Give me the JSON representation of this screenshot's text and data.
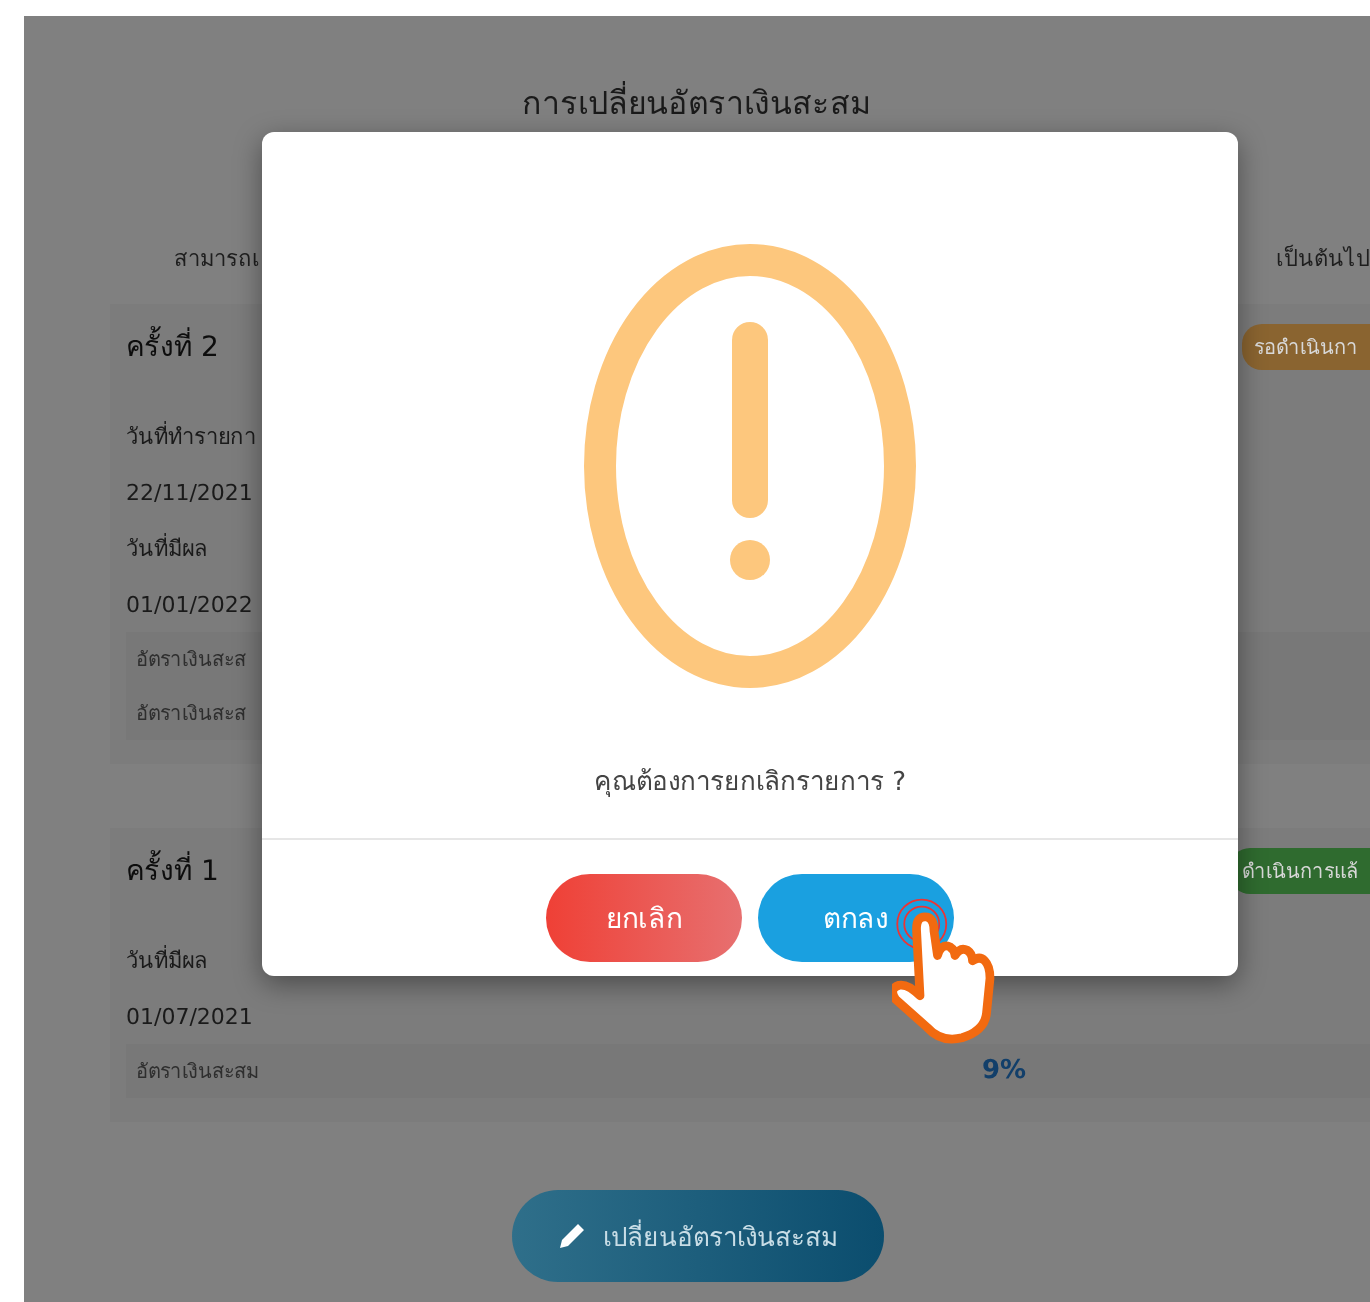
{
  "page": {
    "title": "การเปลี่ยนอัตราเงินสะสม",
    "note_left": "สามารถเ",
    "note_right": "เป็นต้นไป"
  },
  "records": [
    {
      "heading": "ครั้งที่ 2",
      "status": "รอดำเนินกา",
      "color": "#8a6430",
      "fields": [
        {
          "kind": "label",
          "text": "วันที่ทำรายกา"
        },
        {
          "kind": "value",
          "text": "22/11/2021"
        },
        {
          "kind": "label",
          "text": "วันที่มีผล"
        },
        {
          "kind": "value",
          "text": "01/01/2022"
        },
        {
          "kind": "rate",
          "text": "อัตราเงินสะส"
        },
        {
          "kind": "rate",
          "text": "อัตราเงินสะส"
        }
      ]
    },
    {
      "heading": "ครั้งที่ 1",
      "status": "ดำเนินการแล้",
      "color": "#2f6b2f",
      "fields": [
        {
          "kind": "label",
          "text": "วันที่มีผล"
        },
        {
          "kind": "value",
          "text": "01/07/2021"
        },
        {
          "kind": "rate",
          "text": "อัตราเงินสะสม",
          "value": "9%"
        }
      ]
    }
  ],
  "change_button": "เปลี่ยนอัตราเงินสะสม",
  "dialog": {
    "message": "คุณต้องการยกเลิกรายการ ?",
    "buttons": [
      {
        "kind": "cancel",
        "label": "ยกเลิก"
      },
      {
        "kind": "confirm",
        "label": "ตกลง"
      }
    ]
  }
}
